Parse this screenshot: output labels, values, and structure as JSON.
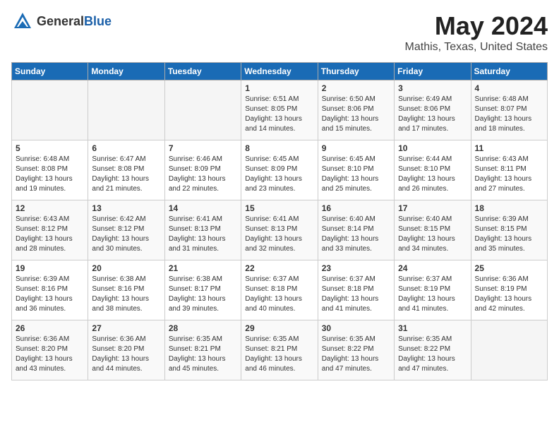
{
  "header": {
    "logo_general": "General",
    "logo_blue": "Blue",
    "month": "May 2024",
    "location": "Mathis, Texas, United States"
  },
  "days_of_week": [
    "Sunday",
    "Monday",
    "Tuesday",
    "Wednesday",
    "Thursday",
    "Friday",
    "Saturday"
  ],
  "weeks": [
    [
      {
        "day": "",
        "info": ""
      },
      {
        "day": "",
        "info": ""
      },
      {
        "day": "",
        "info": ""
      },
      {
        "day": "1",
        "info": "Sunrise: 6:51 AM\nSunset: 8:05 PM\nDaylight: 13 hours\nand 14 minutes."
      },
      {
        "day": "2",
        "info": "Sunrise: 6:50 AM\nSunset: 8:06 PM\nDaylight: 13 hours\nand 15 minutes."
      },
      {
        "day": "3",
        "info": "Sunrise: 6:49 AM\nSunset: 8:06 PM\nDaylight: 13 hours\nand 17 minutes."
      },
      {
        "day": "4",
        "info": "Sunrise: 6:48 AM\nSunset: 8:07 PM\nDaylight: 13 hours\nand 18 minutes."
      }
    ],
    [
      {
        "day": "5",
        "info": "Sunrise: 6:48 AM\nSunset: 8:08 PM\nDaylight: 13 hours\nand 19 minutes."
      },
      {
        "day": "6",
        "info": "Sunrise: 6:47 AM\nSunset: 8:08 PM\nDaylight: 13 hours\nand 21 minutes."
      },
      {
        "day": "7",
        "info": "Sunrise: 6:46 AM\nSunset: 8:09 PM\nDaylight: 13 hours\nand 22 minutes."
      },
      {
        "day": "8",
        "info": "Sunrise: 6:45 AM\nSunset: 8:09 PM\nDaylight: 13 hours\nand 23 minutes."
      },
      {
        "day": "9",
        "info": "Sunrise: 6:45 AM\nSunset: 8:10 PM\nDaylight: 13 hours\nand 25 minutes."
      },
      {
        "day": "10",
        "info": "Sunrise: 6:44 AM\nSunset: 8:10 PM\nDaylight: 13 hours\nand 26 minutes."
      },
      {
        "day": "11",
        "info": "Sunrise: 6:43 AM\nSunset: 8:11 PM\nDaylight: 13 hours\nand 27 minutes."
      }
    ],
    [
      {
        "day": "12",
        "info": "Sunrise: 6:43 AM\nSunset: 8:12 PM\nDaylight: 13 hours\nand 28 minutes."
      },
      {
        "day": "13",
        "info": "Sunrise: 6:42 AM\nSunset: 8:12 PM\nDaylight: 13 hours\nand 30 minutes."
      },
      {
        "day": "14",
        "info": "Sunrise: 6:41 AM\nSunset: 8:13 PM\nDaylight: 13 hours\nand 31 minutes."
      },
      {
        "day": "15",
        "info": "Sunrise: 6:41 AM\nSunset: 8:13 PM\nDaylight: 13 hours\nand 32 minutes."
      },
      {
        "day": "16",
        "info": "Sunrise: 6:40 AM\nSunset: 8:14 PM\nDaylight: 13 hours\nand 33 minutes."
      },
      {
        "day": "17",
        "info": "Sunrise: 6:40 AM\nSunset: 8:15 PM\nDaylight: 13 hours\nand 34 minutes."
      },
      {
        "day": "18",
        "info": "Sunrise: 6:39 AM\nSunset: 8:15 PM\nDaylight: 13 hours\nand 35 minutes."
      }
    ],
    [
      {
        "day": "19",
        "info": "Sunrise: 6:39 AM\nSunset: 8:16 PM\nDaylight: 13 hours\nand 36 minutes."
      },
      {
        "day": "20",
        "info": "Sunrise: 6:38 AM\nSunset: 8:16 PM\nDaylight: 13 hours\nand 38 minutes."
      },
      {
        "day": "21",
        "info": "Sunrise: 6:38 AM\nSunset: 8:17 PM\nDaylight: 13 hours\nand 39 minutes."
      },
      {
        "day": "22",
        "info": "Sunrise: 6:37 AM\nSunset: 8:18 PM\nDaylight: 13 hours\nand 40 minutes."
      },
      {
        "day": "23",
        "info": "Sunrise: 6:37 AM\nSunset: 8:18 PM\nDaylight: 13 hours\nand 41 minutes."
      },
      {
        "day": "24",
        "info": "Sunrise: 6:37 AM\nSunset: 8:19 PM\nDaylight: 13 hours\nand 41 minutes."
      },
      {
        "day": "25",
        "info": "Sunrise: 6:36 AM\nSunset: 8:19 PM\nDaylight: 13 hours\nand 42 minutes."
      }
    ],
    [
      {
        "day": "26",
        "info": "Sunrise: 6:36 AM\nSunset: 8:20 PM\nDaylight: 13 hours\nand 43 minutes."
      },
      {
        "day": "27",
        "info": "Sunrise: 6:36 AM\nSunset: 8:20 PM\nDaylight: 13 hours\nand 44 minutes."
      },
      {
        "day": "28",
        "info": "Sunrise: 6:35 AM\nSunset: 8:21 PM\nDaylight: 13 hours\nand 45 minutes."
      },
      {
        "day": "29",
        "info": "Sunrise: 6:35 AM\nSunset: 8:21 PM\nDaylight: 13 hours\nand 46 minutes."
      },
      {
        "day": "30",
        "info": "Sunrise: 6:35 AM\nSunset: 8:22 PM\nDaylight: 13 hours\nand 47 minutes."
      },
      {
        "day": "31",
        "info": "Sunrise: 6:35 AM\nSunset: 8:22 PM\nDaylight: 13 hours\nand 47 minutes."
      },
      {
        "day": "",
        "info": ""
      }
    ]
  ]
}
